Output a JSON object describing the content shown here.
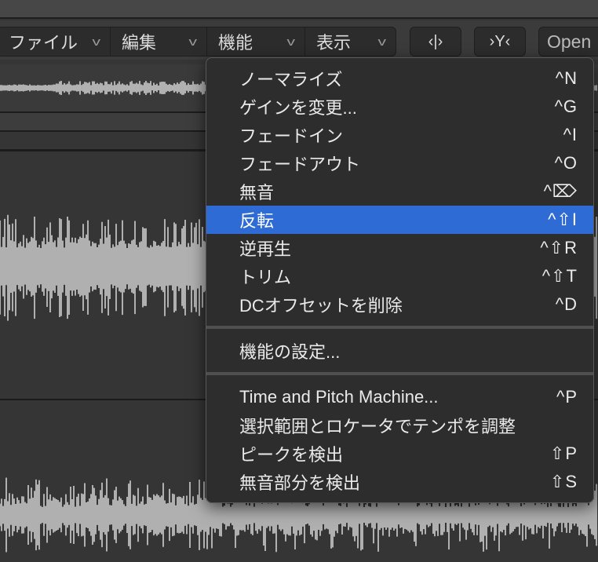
{
  "toolbar": {
    "menus": [
      {
        "label": "ファイル"
      },
      {
        "label": "編集"
      },
      {
        "label": "機能"
      },
      {
        "label": "表示"
      }
    ],
    "buttons": [
      {
        "label": "‹|›"
      },
      {
        "label": "›Y‹"
      },
      {
        "label": "Open"
      }
    ]
  },
  "menu": {
    "groups": [
      [
        {
          "label": "ノーマライズ",
          "shortcut": "^N"
        },
        {
          "label": "ゲインを変更...",
          "shortcut": "^G"
        },
        {
          "label": "フェードイン",
          "shortcut": "^I"
        },
        {
          "label": "フェードアウト",
          "shortcut": "^O"
        },
        {
          "label": "無音",
          "shortcut": "^⌦"
        },
        {
          "label": "反転",
          "shortcut": "^⇧I",
          "highlighted": true
        },
        {
          "label": "逆再生",
          "shortcut": "^⇧R"
        },
        {
          "label": "トリム",
          "shortcut": "^⇧T"
        },
        {
          "label": "DCオフセットを削除",
          "shortcut": "^D"
        }
      ],
      [
        {
          "label": "機能の設定...",
          "shortcut": ""
        }
      ],
      [
        {
          "label": "Time and Pitch Machine...",
          "shortcut": "^P"
        },
        {
          "label": "選択範囲とロケータでテンポを調整",
          "shortcut": ""
        },
        {
          "label": "ピークを検出",
          "shortcut": "⇧P"
        },
        {
          "label": "無音部分を検出",
          "shortcut": "⇧S"
        }
      ]
    ]
  },
  "colors": {
    "highlight": "#2f6bd5",
    "waveform": "#f2f2f2"
  }
}
